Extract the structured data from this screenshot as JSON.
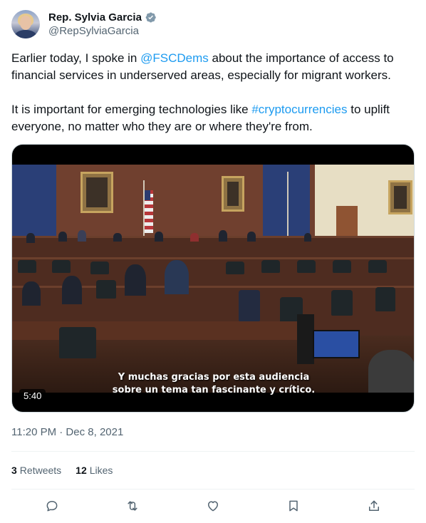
{
  "author": {
    "display_name": "Rep. Sylvia Garcia",
    "handle": "@RepSylviaGarcia",
    "verified": true,
    "avatar_icon": "avatar-photo"
  },
  "tweet": {
    "p1_a": "Earlier today, I spoke in ",
    "p1_mention": "@FSCDems",
    "p1_b": " about the importance of access to financial services in underserved areas, especially for migrant workers.",
    "p2_a": "It is important for emerging technologies like ",
    "p2_hashtag": "#cryptocurrencies",
    "p2_b": " to uplift everyone, no matter who they are or where they're from."
  },
  "media": {
    "subtitle_line1": "Y muchas gracias por esta audiencia",
    "subtitle_line2": "sobre un tema tan fascinante y crítico.",
    "duration": "5:40"
  },
  "timestamp": "11:20 PM · Dec 8, 2021",
  "stats": {
    "retweets_count": "3",
    "retweets_label": "Retweets",
    "likes_count": "12",
    "likes_label": "Likes"
  },
  "actions": [
    "reply-icon",
    "retweet-icon",
    "like-icon",
    "bookmark-icon",
    "share-icon"
  ],
  "colors": {
    "link": "#1d9bf0",
    "secondary_text": "#536471",
    "primary_text": "#0f1419",
    "verified_badge": "#829aab"
  }
}
